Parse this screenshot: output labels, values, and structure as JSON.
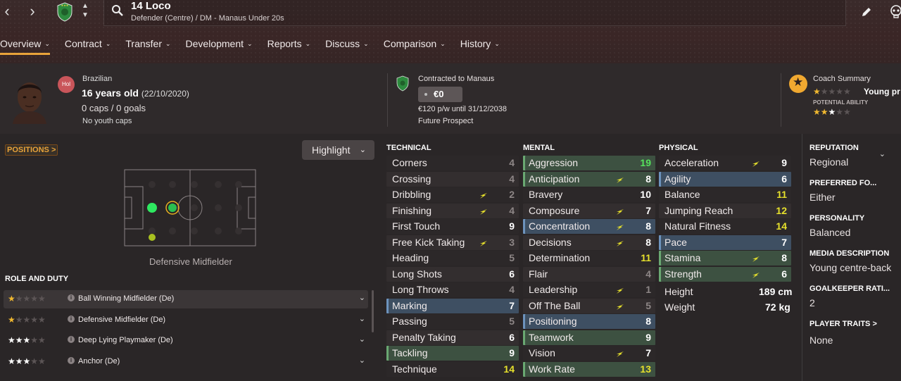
{
  "header": {
    "player_name": "14 Loco",
    "player_subtitle": "Defender (Centre) / DM - Manaus Under 20s",
    "back_icon": "chevron-left-icon",
    "forward_icon": "chevron-right-icon"
  },
  "tabs": [
    {
      "label": "Overview"
    },
    {
      "label": "Contract"
    },
    {
      "label": "Transfer"
    },
    {
      "label": "Development"
    },
    {
      "label": "Reports"
    },
    {
      "label": "Discuss"
    },
    {
      "label": "Comparison"
    },
    {
      "label": "History"
    }
  ],
  "summary": {
    "nat_badge": "Hol",
    "nationality": "Brazilian",
    "age": "16 years old",
    "dob": "(22/10/2020)",
    "caps": "0 caps / 0 goals",
    "youth": "No youth caps",
    "contract_title": "Contracted to Manaus",
    "value": "€0",
    "wage": "€120 p/w until 31/12/2038",
    "status": "Future Prospect",
    "coach_title": "Coach Summary",
    "coach_text": "Young pr",
    "potential_label": "POTENTIAL ABILITY"
  },
  "positions": {
    "link": "POSITIONS >",
    "highlight": "Highlight",
    "pitch_label": "Defensive Midfielder"
  },
  "roles": {
    "title": "ROLE AND DUTY",
    "items": [
      {
        "name": "Ball Winning Midfielder (De)",
        "stars": 1
      },
      {
        "name": "Defensive Midfielder (De)",
        "stars": 1
      },
      {
        "name": "Deep Lying Playmaker (De)",
        "stars": 3
      },
      {
        "name": "Anchor (De)",
        "stars": 3
      }
    ]
  },
  "technical": {
    "title": "TECHNICAL",
    "items": [
      {
        "name": "Corners",
        "value": "4"
      },
      {
        "name": "Crossing",
        "value": "4"
      },
      {
        "name": "Dribbling",
        "value": "2"
      },
      {
        "name": "Finishing",
        "value": "4"
      },
      {
        "name": "First Touch",
        "value": "9"
      },
      {
        "name": "Free Kick Taking",
        "value": "3"
      },
      {
        "name": "Heading",
        "value": "5"
      },
      {
        "name": "Long Shots",
        "value": "6"
      },
      {
        "name": "Long Throws",
        "value": "4"
      },
      {
        "name": "Marking",
        "value": "7"
      },
      {
        "name": "Passing",
        "value": "5"
      },
      {
        "name": "Penalty Taking",
        "value": "6"
      },
      {
        "name": "Tackling",
        "value": "9"
      },
      {
        "name": "Technique",
        "value": "14"
      }
    ]
  },
  "mental": {
    "title": "MENTAL",
    "items": [
      {
        "name": "Aggression",
        "value": "19"
      },
      {
        "name": "Anticipation",
        "value": "8"
      },
      {
        "name": "Bravery",
        "value": "10"
      },
      {
        "name": "Composure",
        "value": "7"
      },
      {
        "name": "Concentration",
        "value": "8"
      },
      {
        "name": "Decisions",
        "value": "8"
      },
      {
        "name": "Determination",
        "value": "11"
      },
      {
        "name": "Flair",
        "value": "4"
      },
      {
        "name": "Leadership",
        "value": "1"
      },
      {
        "name": "Off The Ball",
        "value": "5"
      },
      {
        "name": "Positioning",
        "value": "8"
      },
      {
        "name": "Teamwork",
        "value": "9"
      },
      {
        "name": "Vision",
        "value": "7"
      },
      {
        "name": "Work Rate",
        "value": "13"
      }
    ]
  },
  "physical": {
    "title": "PHYSICAL",
    "items": [
      {
        "name": "Acceleration",
        "value": "9"
      },
      {
        "name": "Agility",
        "value": "6"
      },
      {
        "name": "Balance",
        "value": "11"
      },
      {
        "name": "Jumping Reach",
        "value": "12"
      },
      {
        "name": "Natural Fitness",
        "value": "14"
      },
      {
        "name": "Pace",
        "value": "7"
      },
      {
        "name": "Stamina",
        "value": "8"
      },
      {
        "name": "Strength",
        "value": "6"
      }
    ],
    "height_label": "Height",
    "height_value": "189 cm",
    "weight_label": "Weight",
    "weight_value": "72 kg"
  },
  "info": {
    "reputation_label": "REPUTATION",
    "reputation_value": "Regional",
    "foot_label": "PREFERRED FO...",
    "foot_value": "Either",
    "personality_label": "PERSONALITY",
    "personality_value": "Balanced",
    "media_label": "MEDIA DESCRIPTION",
    "media_value": "Young centre-back",
    "gk_label": "GOALKEEPER RATI...",
    "gk_value": "2",
    "traits_label": "PLAYER TRAITS >",
    "traits_value": "None"
  },
  "colors": {
    "accent": "#e8a33a",
    "value_green": "#56e25c",
    "value_yellow": "#e6e02c",
    "value_grey": "#8d8686",
    "highlight_blue": "#3e4f62",
    "highlight_green": "#3d5141"
  }
}
